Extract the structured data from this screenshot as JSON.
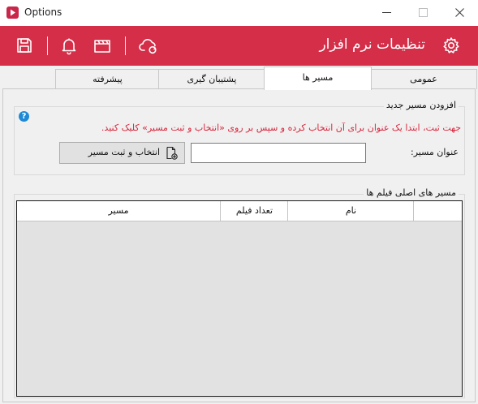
{
  "window": {
    "title": "Options",
    "icon": "app-play-icon",
    "controls": [
      "minimize-icon",
      "maximize-icon",
      "close-icon"
    ]
  },
  "toolbar": {
    "title": "تنظیمات نرم افزار",
    "background": "#d42e48",
    "icons": [
      "save-icon",
      "bell-icon",
      "clapperboard-icon",
      "cloud-sync-icon",
      "gear-icon"
    ]
  },
  "tabs": [
    {
      "label": "پیشرفته",
      "active": false
    },
    {
      "label": "پشتیبان گیری",
      "active": false
    },
    {
      "label": "مسیر ها",
      "active": true
    },
    {
      "label": "عمومی",
      "active": false
    }
  ],
  "add_path": {
    "legend": "افزودن مسیر جدید",
    "hint": "جهت ثبت، ابتدا یک عنوان برای آن انتخاب کرده و سپس بر روی «انتخاب و ثبت مسیر» کلیک کنید.",
    "hint_color": "#d7263d",
    "field_label": "عنوان مسیر:",
    "field_value": "",
    "button_label": "انتخاب و ثبت مسیر"
  },
  "paths_table": {
    "legend": "مسیر های اصلی فیلم ها",
    "columns": [
      "",
      "نام",
      "تعداد فیلم",
      "مسیر"
    ],
    "rows": []
  }
}
